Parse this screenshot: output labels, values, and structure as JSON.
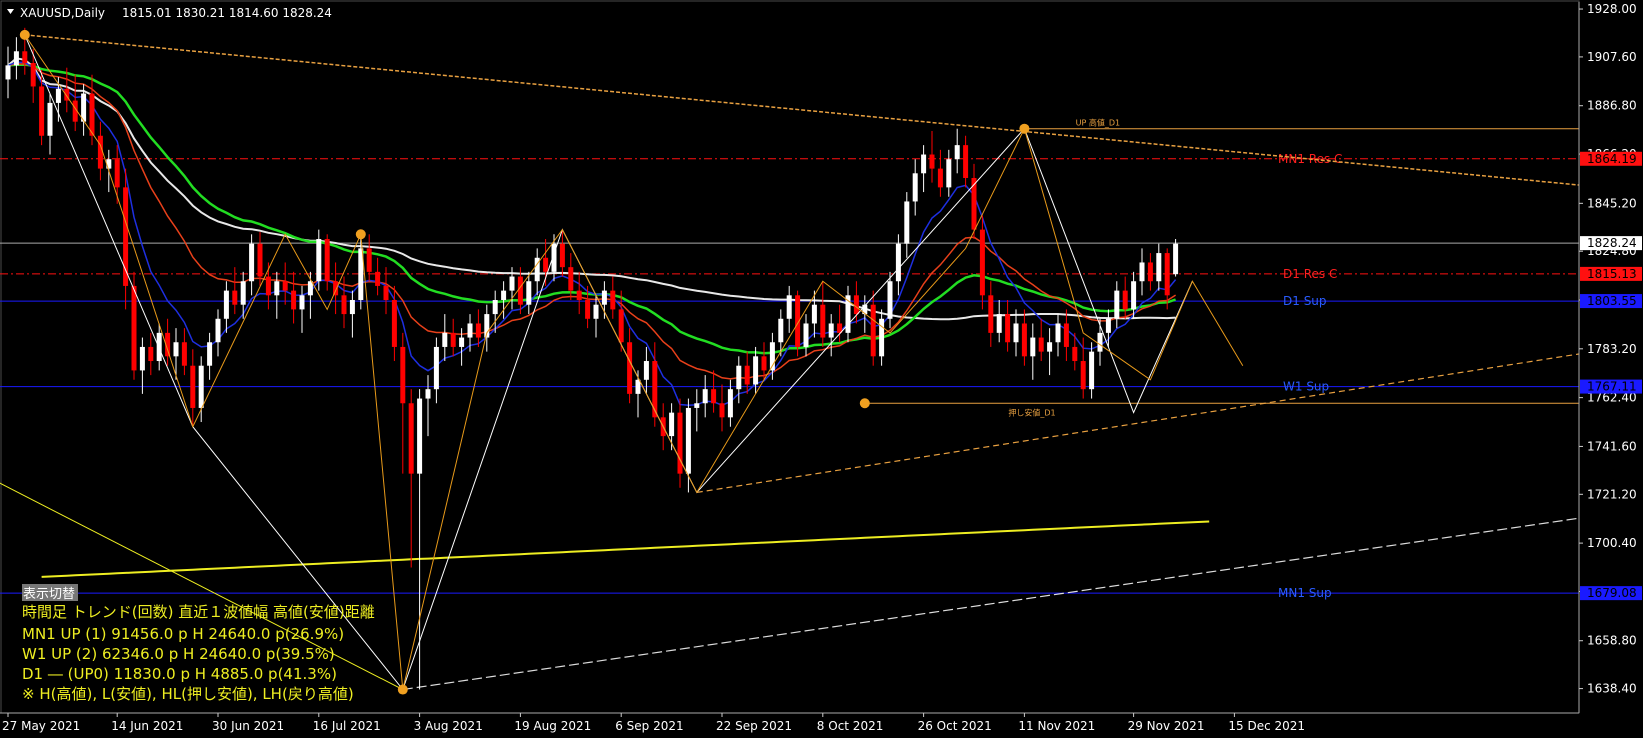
{
  "window": {
    "title": "XAUUSD,Daily",
    "ohlc": "1815.01 1830.21 1814.60 1828.24"
  },
  "colors": {
    "background": "#000000",
    "bull": "#FFFFFF",
    "bear": "#FF0000",
    "ma_blue": "#1E2FE0",
    "ma_orange": "#E8401A",
    "ma_green": "#22DD22",
    "ma_white": "#E8E8E8",
    "ma_yellow": "#EEEE22",
    "zigzag": "#E89A1A",
    "level_red": "#FF1010",
    "level_blue": "#1A1AFF"
  },
  "levels": [
    {
      "name": "MN1 Res C",
      "price": 1864.19,
      "color": "#FF1010",
      "style": "dashdot",
      "label_color": "#FF2020"
    },
    {
      "name": "D1 Res C",
      "price": 1815.13,
      "color": "#FF1010",
      "style": "dashdot",
      "label_color": "#FF2020"
    },
    {
      "name": "D1 Sup",
      "price": 1803.55,
      "color": "#1A1AFF",
      "style": "solid",
      "label_color": "#2A5CFF"
    },
    {
      "name": "W1 Sup",
      "price": 1767.11,
      "color": "#1A1AFF",
      "style": "solid",
      "label_color": "#2A5CFF"
    },
    {
      "name": "MN1 Sup",
      "price": 1679.08,
      "color": "#1A1AFF",
      "style": "solid",
      "label_color": "#2A5CFF"
    }
  ],
  "markers": [
    {
      "label": "UP 高値_D1",
      "date_index": 129,
      "price": 1877
    },
    {
      "label": "押し安値_D1",
      "date_index": 121,
      "price": 1760
    }
  ],
  "info_panel": {
    "toggle": "表示切替",
    "header": "時間足 トレンド(回数) 直近１波値幅 高値(安値)距離",
    "rows": [
      "MN1 UP (1)    91456.0 p  H 24640.0 p(26.9%)",
      "W1   UP (2)    62346.0 p  H 24640.0 p(39.5%)",
      "D1    ―  (UP0) 11830.0 p  H 4885.0 p(41.3%)",
      "※ H(高値), L(安値), HL(押し安値), LH(戻り高値)"
    ]
  },
  "chart_data": {
    "type": "candlestick",
    "symbol": "XAUUSD",
    "timeframe": "Daily",
    "ylim": [
      1628.0,
      1931.0
    ],
    "y_ticks": [
      1928.0,
      1907.6,
      1886.8,
      1866.2,
      1845.2,
      1824.8,
      1804.0,
      1783.2,
      1762.4,
      1741.6,
      1721.2,
      1700.4,
      1679.8,
      1658.8,
      1638.4
    ],
    "current_price": 1828.24,
    "x_labels": [
      {
        "label": "27 May 2021",
        "index": 0
      },
      {
        "label": "14 Jun 2021",
        "index": 13
      },
      {
        "label": "30 Jun 2021",
        "index": 25
      },
      {
        "label": "16 Jul 2021",
        "index": 37
      },
      {
        "label": "3 Aug 2021",
        "index": 49
      },
      {
        "label": "19 Aug 2021",
        "index": 61
      },
      {
        "label": "6 Sep 2021",
        "index": 73
      },
      {
        "label": "22 Sep 2021",
        "index": 85
      },
      {
        "label": "8 Oct 2021",
        "index": 97
      },
      {
        "label": "26 Oct 2021",
        "index": 109
      },
      {
        "label": "11 Nov 2021",
        "index": 121
      },
      {
        "label": "29 Nov 2021",
        "index": 134
      },
      {
        "label": "15 Dec 2021",
        "index": 146
      }
    ],
    "ohlc": [
      [
        1898,
        1912,
        1890,
        1904
      ],
      [
        1904,
        1916,
        1898,
        1910
      ],
      [
        1910,
        1920,
        1900,
        1905
      ],
      [
        1905,
        1911,
        1888,
        1895
      ],
      [
        1895,
        1902,
        1870,
        1874
      ],
      [
        1874,
        1892,
        1866,
        1888
      ],
      [
        1888,
        1899,
        1880,
        1894
      ],
      [
        1894,
        1903,
        1884,
        1889
      ],
      [
        1889,
        1900,
        1876,
        1880
      ],
      [
        1880,
        1896,
        1874,
        1892
      ],
      [
        1892,
        1900,
        1870,
        1874
      ],
      [
        1874,
        1880,
        1855,
        1860
      ],
      [
        1860,
        1868,
        1850,
        1864
      ],
      [
        1864,
        1870,
        1845,
        1852
      ],
      [
        1852,
        1860,
        1800,
        1810
      ],
      [
        1810,
        1816,
        1770,
        1774
      ],
      [
        1774,
        1788,
        1764,
        1784
      ],
      [
        1784,
        1790,
        1772,
        1778
      ],
      [
        1778,
        1794,
        1774,
        1790
      ],
      [
        1790,
        1796,
        1776,
        1780
      ],
      [
        1780,
        1792,
        1770,
        1786
      ],
      [
        1786,
        1792,
        1772,
        1776
      ],
      [
        1776,
        1783,
        1750,
        1758
      ],
      [
        1758,
        1780,
        1752,
        1776
      ],
      [
        1776,
        1790,
        1770,
        1786
      ],
      [
        1786,
        1800,
        1780,
        1796
      ],
      [
        1796,
        1812,
        1790,
        1808
      ],
      [
        1808,
        1818,
        1798,
        1802
      ],
      [
        1802,
        1816,
        1796,
        1812
      ],
      [
        1812,
        1832,
        1806,
        1828
      ],
      [
        1828,
        1833,
        1810,
        1814
      ],
      [
        1814,
        1820,
        1800,
        1806
      ],
      [
        1806,
        1816,
        1796,
        1812
      ],
      [
        1812,
        1820,
        1802,
        1808
      ],
      [
        1808,
        1816,
        1794,
        1800
      ],
      [
        1800,
        1810,
        1790,
        1806
      ],
      [
        1806,
        1816,
        1796,
        1812
      ],
      [
        1812,
        1834,
        1808,
        1830
      ],
      [
        1830,
        1832,
        1808,
        1812
      ],
      [
        1812,
        1820,
        1798,
        1806
      ],
      [
        1806,
        1814,
        1792,
        1798
      ],
      [
        1798,
        1808,
        1788,
        1804
      ],
      [
        1804,
        1832,
        1800,
        1826
      ],
      [
        1826,
        1832,
        1812,
        1816
      ],
      [
        1816,
        1822,
        1806,
        1810
      ],
      [
        1810,
        1818,
        1798,
        1804
      ],
      [
        1804,
        1810,
        1778,
        1784
      ],
      [
        1784,
        1790,
        1730,
        1760
      ],
      [
        1760,
        1766,
        1690,
        1730
      ],
      [
        1730,
        1766,
        1638,
        1762
      ],
      [
        1762,
        1772,
        1746,
        1766
      ],
      [
        1766,
        1788,
        1760,
        1784
      ],
      [
        1784,
        1798,
        1778,
        1790
      ],
      [
        1790,
        1796,
        1780,
        1784
      ],
      [
        1784,
        1792,
        1776,
        1788
      ],
      [
        1788,
        1798,
        1782,
        1794
      ],
      [
        1794,
        1800,
        1784,
        1788
      ],
      [
        1788,
        1802,
        1782,
        1798
      ],
      [
        1798,
        1808,
        1790,
        1804
      ],
      [
        1804,
        1812,
        1796,
        1808
      ],
      [
        1808,
        1818,
        1800,
        1814
      ],
      [
        1814,
        1818,
        1798,
        1802
      ],
      [
        1802,
        1816,
        1798,
        1812
      ],
      [
        1812,
        1826,
        1806,
        1822
      ],
      [
        1822,
        1830,
        1810,
        1816
      ],
      [
        1816,
        1832,
        1812,
        1828
      ],
      [
        1828,
        1834,
        1814,
        1818
      ],
      [
        1818,
        1824,
        1804,
        1808
      ],
      [
        1808,
        1816,
        1798,
        1804
      ],
      [
        1804,
        1810,
        1792,
        1796
      ],
      [
        1796,
        1806,
        1788,
        1802
      ],
      [
        1802,
        1812,
        1796,
        1808
      ],
      [
        1808,
        1814,
        1796,
        1800
      ],
      [
        1800,
        1808,
        1782,
        1786
      ],
      [
        1786,
        1792,
        1760,
        1764
      ],
      [
        1764,
        1774,
        1754,
        1770
      ],
      [
        1770,
        1784,
        1764,
        1778
      ],
      [
        1778,
        1786,
        1750,
        1754
      ],
      [
        1754,
        1760,
        1740,
        1746
      ],
      [
        1746,
        1760,
        1740,
        1756
      ],
      [
        1756,
        1762,
        1724,
        1730
      ],
      [
        1730,
        1762,
        1722,
        1758
      ],
      [
        1758,
        1766,
        1748,
        1760
      ],
      [
        1760,
        1772,
        1754,
        1766
      ],
      [
        1766,
        1774,
        1756,
        1760
      ],
      [
        1760,
        1768,
        1748,
        1754
      ],
      [
        1754,
        1770,
        1750,
        1766
      ],
      [
        1766,
        1780,
        1760,
        1776
      ],
      [
        1776,
        1782,
        1764,
        1768
      ],
      [
        1768,
        1784,
        1764,
        1780
      ],
      [
        1780,
        1786,
        1770,
        1774
      ],
      [
        1774,
        1790,
        1770,
        1786
      ],
      [
        1786,
        1800,
        1780,
        1796
      ],
      [
        1796,
        1810,
        1790,
        1806
      ],
      [
        1806,
        1808,
        1780,
        1784
      ],
      [
        1784,
        1798,
        1780,
        1794
      ],
      [
        1794,
        1808,
        1788,
        1802
      ],
      [
        1802,
        1812,
        1784,
        1788
      ],
      [
        1788,
        1798,
        1780,
        1794
      ],
      [
        1794,
        1802,
        1786,
        1790
      ],
      [
        1790,
        1810,
        1786,
        1806
      ],
      [
        1806,
        1812,
        1794,
        1798
      ],
      [
        1798,
        1806,
        1790,
        1802
      ],
      [
        1802,
        1808,
        1776,
        1780
      ],
      [
        1780,
        1800,
        1776,
        1796
      ],
      [
        1796,
        1816,
        1792,
        1812
      ],
      [
        1812,
        1832,
        1806,
        1828
      ],
      [
        1828,
        1850,
        1822,
        1846
      ],
      [
        1846,
        1864,
        1840,
        1858
      ],
      [
        1858,
        1870,
        1850,
        1866
      ],
      [
        1866,
        1876,
        1854,
        1860
      ],
      [
        1860,
        1868,
        1848,
        1852
      ],
      [
        1852,
        1868,
        1848,
        1864
      ],
      [
        1864,
        1877,
        1858,
        1870
      ],
      [
        1870,
        1874,
        1852,
        1856
      ],
      [
        1856,
        1862,
        1830,
        1834
      ],
      [
        1834,
        1840,
        1800,
        1806
      ],
      [
        1806,
        1812,
        1784,
        1790
      ],
      [
        1790,
        1804,
        1786,
        1798
      ],
      [
        1798,
        1804,
        1782,
        1786
      ],
      [
        1786,
        1800,
        1780,
        1794
      ],
      [
        1794,
        1800,
        1776,
        1780
      ],
      [
        1780,
        1794,
        1770,
        1788
      ],
      [
        1788,
        1796,
        1778,
        1782
      ],
      [
        1782,
        1792,
        1772,
        1786
      ],
      [
        1786,
        1798,
        1780,
        1794
      ],
      [
        1794,
        1800,
        1778,
        1784
      ],
      [
        1784,
        1790,
        1774,
        1778
      ],
      [
        1778,
        1788,
        1762,
        1766
      ],
      [
        1766,
        1786,
        1762,
        1782
      ],
      [
        1782,
        1796,
        1776,
        1790
      ],
      [
        1790,
        1800,
        1784,
        1796
      ],
      [
        1796,
        1812,
        1792,
        1808
      ],
      [
        1808,
        1814,
        1796,
        1800
      ],
      [
        1800,
        1816,
        1796,
        1812
      ],
      [
        1812,
        1826,
        1806,
        1820
      ],
      [
        1820,
        1824,
        1808,
        1812
      ],
      [
        1812,
        1828,
        1808,
        1824
      ],
      [
        1824,
        1826,
        1800,
        1806
      ],
      [
        1815,
        1830,
        1814,
        1828
      ]
    ]
  }
}
